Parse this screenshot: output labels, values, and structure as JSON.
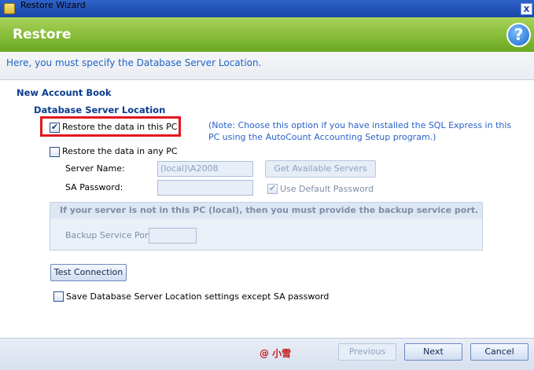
{
  "window": {
    "title": "Restore Wizard",
    "close_glyph": "x"
  },
  "header": {
    "title": "Restore",
    "help_glyph": "?"
  },
  "subtitle": "Here, you must specify the Database Server Location.",
  "sections": {
    "account_book": "New Account Book",
    "server_location": "Database Server Location"
  },
  "options": {
    "restore_this_pc": {
      "label": "Restore the data in this PC",
      "checked": true
    },
    "restore_any_pc": {
      "label": "Restore the data in any PC",
      "checked": false
    },
    "note": "(Note: Choose this option if you have installed the SQL Express in this PC using the AutoCount Accounting Setup program.)"
  },
  "server": {
    "name_label": "Server Name:",
    "name_value": "(local)\\A2008",
    "sa_label": "SA Password:",
    "sa_value": "",
    "get_servers_label": "Get Available Servers",
    "use_default_password_label": "Use Default Password",
    "use_default_password_checked": true
  },
  "backup": {
    "header": "If your server is not in this PC (local), then you must provide the backup service port.",
    "port_label": "Backup Service Port:",
    "port_value": ""
  },
  "test_connection_label": "Test Connection",
  "save_settings": {
    "label": "Save Database Server Location settings except SA password",
    "checked": false
  },
  "footer": {
    "watermark": "@ 小雪",
    "previous_label": "Previous",
    "next_label": "Next",
    "cancel_label": "Cancel"
  }
}
